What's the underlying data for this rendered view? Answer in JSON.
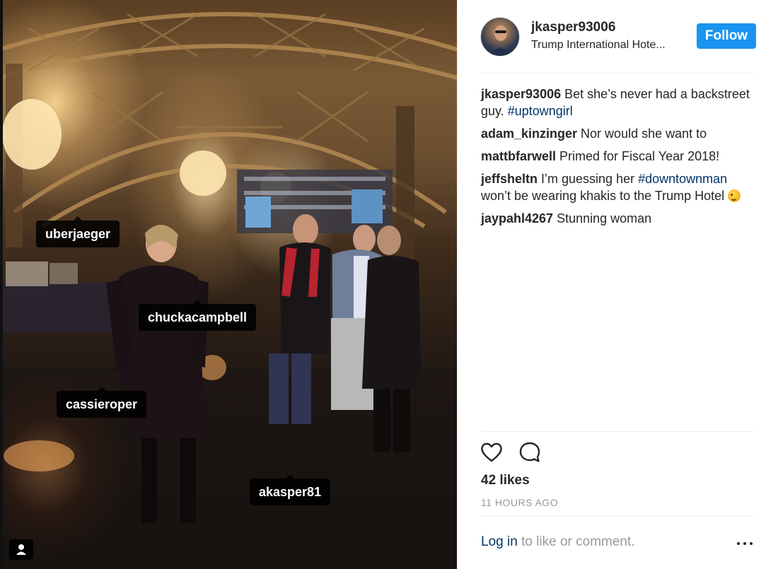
{
  "post": {
    "author": "jkasper93006",
    "location": "Trump International Hote...",
    "follow_label": "Follow",
    "likes": "42 likes",
    "time": "11 HOURS AGO",
    "login_link": "Log in",
    "login_suffix": " to like or comment."
  },
  "photo_tags": [
    {
      "username": "uberjaeger"
    },
    {
      "username": "chuckacampbell"
    },
    {
      "username": "cassieroper"
    },
    {
      "username": "akasper81"
    }
  ],
  "comments": [
    {
      "user": "jkasper93006",
      "text": " Bet she’s never had a backstreet guy. ",
      "hashtag": "#uptowngirl",
      "tail": ""
    },
    {
      "user": "adam_kinzinger",
      "text": " Nor would she want to",
      "hashtag": "",
      "tail": ""
    },
    {
      "user": "mattbfarwell",
      "text": " Primed for Fiscal Year 2018!",
      "hashtag": "",
      "tail": ""
    },
    {
      "user": "jeffsheltn",
      "text": " I’m guessing her ",
      "hashtag": "#downtownman",
      "tail": " won’t be wearing khakis to the Trump Hotel "
    },
    {
      "user": "jaypahl4267",
      "text": " Stunning woman",
      "hashtag": "",
      "tail": ""
    }
  ],
  "colors": {
    "accent": "#1a94f0",
    "link": "#003569",
    "muted": "#999999"
  },
  "icons": [
    "heart-icon",
    "comment-icon",
    "more-options-icon",
    "user-tag-icon",
    "winking-emoji-icon"
  ]
}
